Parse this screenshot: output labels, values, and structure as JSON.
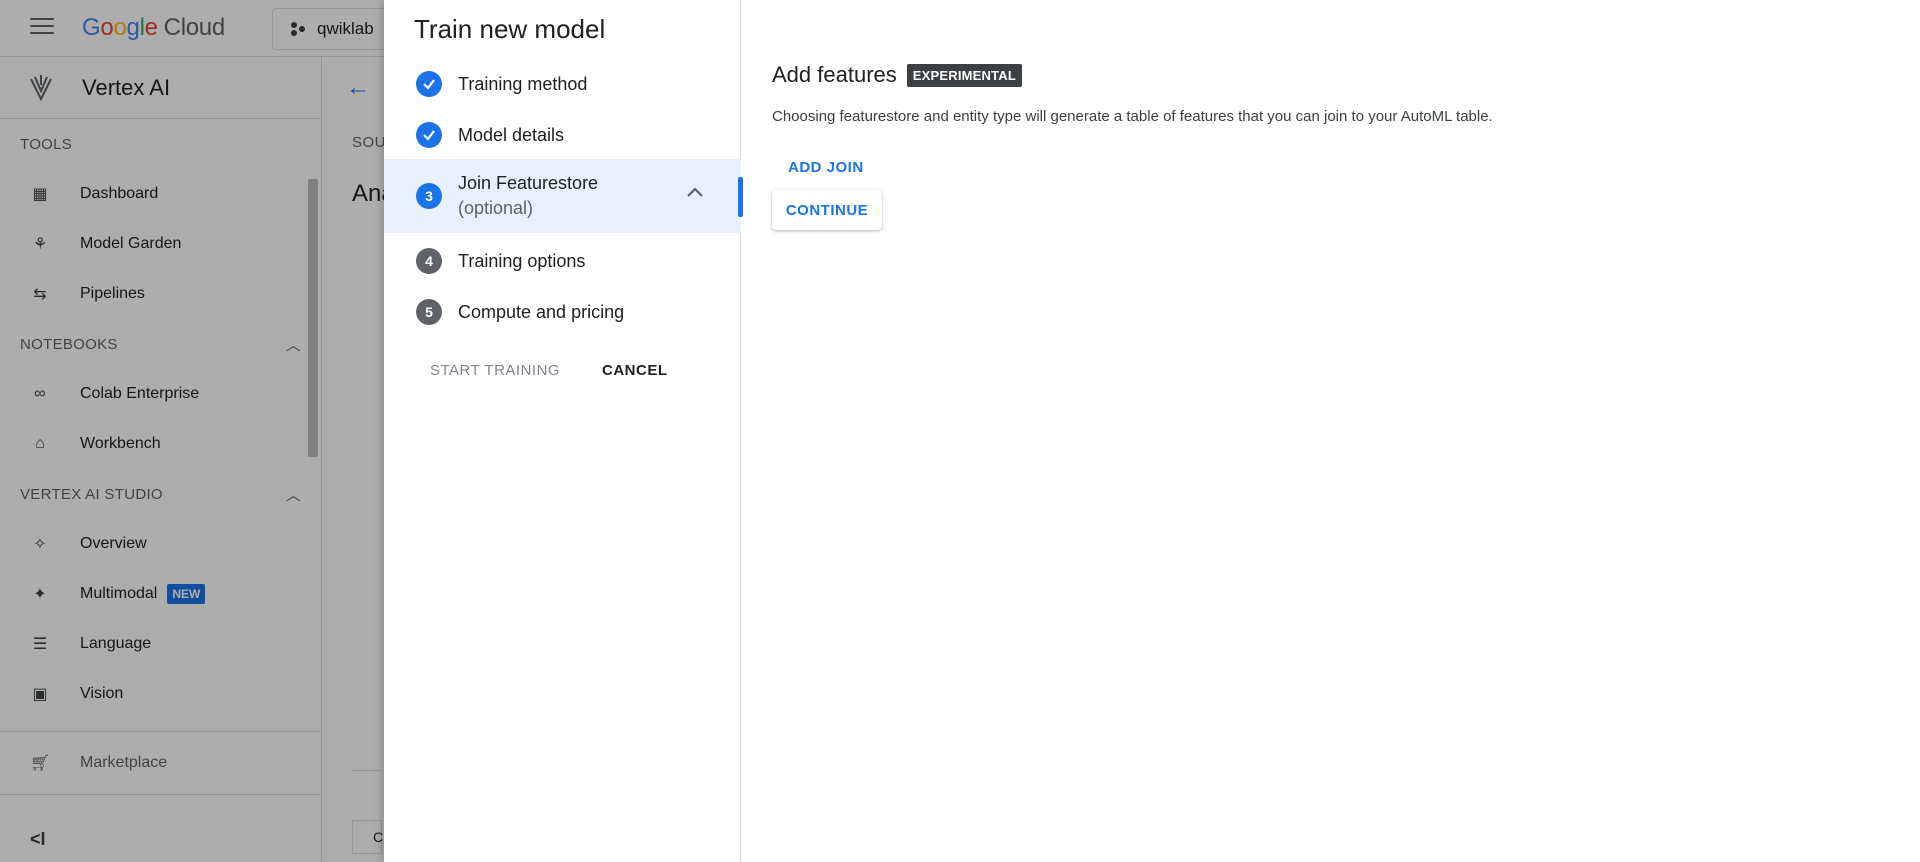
{
  "topbar": {
    "logo_google": [
      "G",
      "o",
      "o",
      "g",
      "l",
      "e"
    ],
    "logo_cloud": "Cloud",
    "project": "qwiklab"
  },
  "sidebar": {
    "product": "Vertex AI",
    "tools_label": "TOOLS",
    "tools": [
      "Dashboard",
      "Model Garden",
      "Pipelines"
    ],
    "notebooks_label": "NOTEBOOKS",
    "notebooks": [
      "Colab Enterprise",
      "Workbench"
    ],
    "studio_label": "VERTEX AI STUDIO",
    "studio": [
      "Overview",
      "Multimodal",
      "Language",
      "Vision"
    ],
    "new_badge": "NEW",
    "marketplace": "Marketplace"
  },
  "main": {
    "tab_partial": "SOU",
    "heading_partial": "Ana",
    "row_partial": "C"
  },
  "panel": {
    "title": "Train new model",
    "steps": [
      {
        "label": "Training method",
        "status": "done"
      },
      {
        "label": "Model details",
        "status": "done"
      },
      {
        "number": "3",
        "label": "Join Featurestore",
        "sub": "(optional)",
        "status": "current"
      },
      {
        "number": "4",
        "label": "Training options",
        "status": "todo"
      },
      {
        "number": "5",
        "label": "Compute and pricing",
        "status": "todo"
      }
    ],
    "start_training": "START TRAINING",
    "cancel": "CANCEL"
  },
  "content": {
    "heading": "Add features",
    "badge": "EXPERIMENTAL",
    "description": "Choosing featurestore and entity type will generate a table of features that you can join to your AutoML table.",
    "add_join": "ADD JOIN",
    "continue": "CONTINUE"
  },
  "colors": {
    "accent": "#1a73e8",
    "active_step_bg": "#e8f0fe",
    "scrim": "rgba(0,0,0,0.32)"
  }
}
